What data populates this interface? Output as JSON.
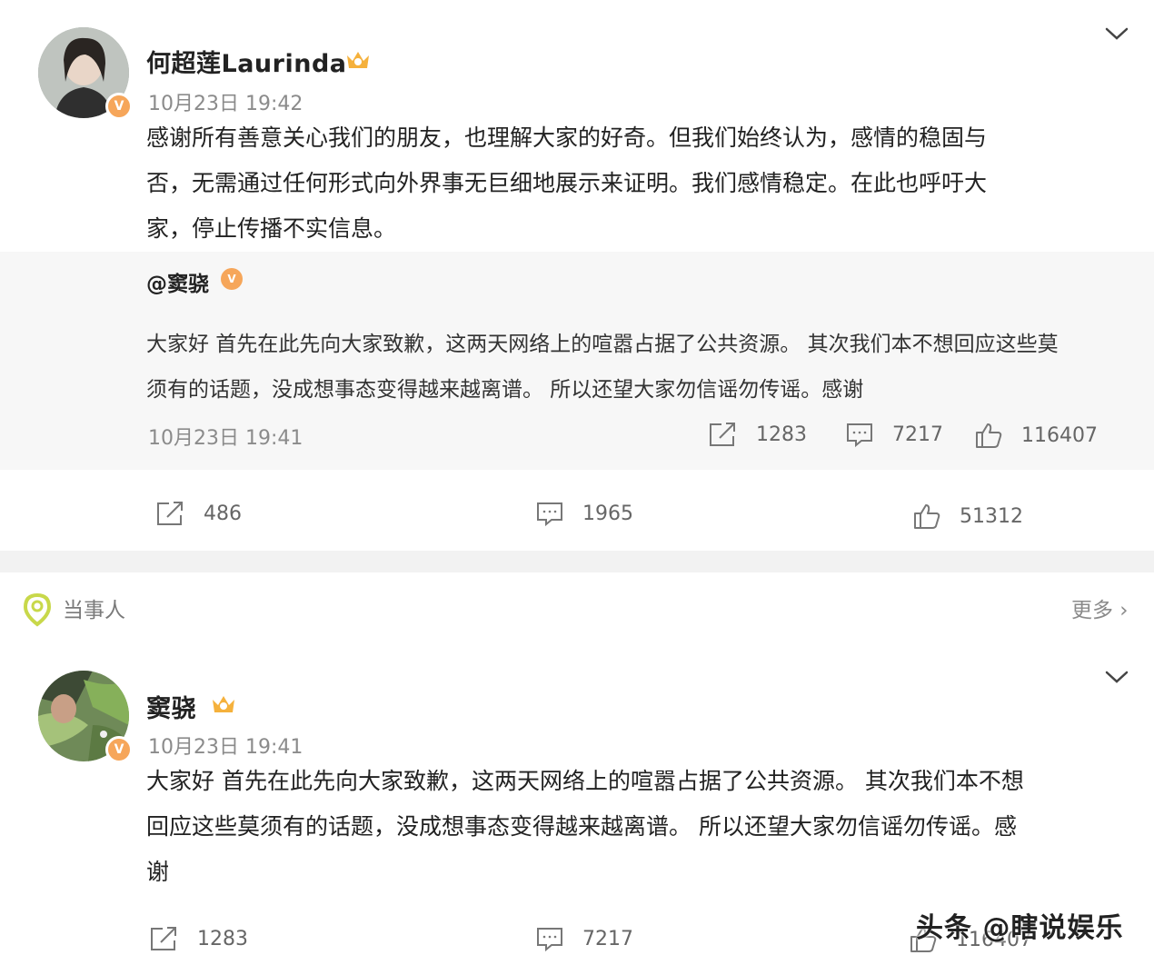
{
  "post1": {
    "author": "何超莲Laurinda",
    "time": "10月23日 19:42",
    "text_lines": [
      "感谢所有善意关心我们的朋友，也理解大家的好奇。但我们始终认为，感情的稳固与",
      "否，无需通过任何形式向外界事无巨细地展示来证明。我们感情稳定。在此也呼吁大",
      "家，停止传播不实信息。"
    ],
    "repost": {
      "author": "@窦骁",
      "text_lines": [
        "大家好 首先在此先向大家致歉，这两天网络上的喧嚣占据了公共资源。 其次我们本不想回应这些莫",
        "须有的话题，没成想事态变得越来越离谱。 所以还望大家勿信谣勿传谣。感谢"
      ],
      "time": "10月23日 19:41",
      "shares": "1283",
      "comments": "7217",
      "likes": "116407"
    },
    "shares": "486",
    "comments": "1965",
    "likes": "51312"
  },
  "section": {
    "label": "当事人",
    "more": "更多 ›"
  },
  "post2": {
    "author": "窦骁",
    "time": "10月23日 19:41",
    "text_lines": [
      "大家好 首先在此先向大家致歉，这两天网络上的喧嚣占据了公共资源。 其次我们本不想",
      "回应这些莫须有的话题，没成想事态变得越来越离谱。 所以还望大家勿信谣勿传谣。感",
      "谢"
    ],
    "shares": "1283",
    "comments": "7217",
    "likes": "116407"
  },
  "watermark": "头条 @瞎说娱乐",
  "icons": {
    "share": "share-icon",
    "comment": "comment-icon",
    "like": "thumbs-up-icon",
    "expand": "chevron-down-icon",
    "crown": "crown-badge-icon",
    "location": "location-pin-icon"
  },
  "colors": {
    "verified_badge": "#f6a65a",
    "crown": "#f5b13c",
    "location_pin": "#c8d84a",
    "muted_text": "#8b8b8b"
  }
}
